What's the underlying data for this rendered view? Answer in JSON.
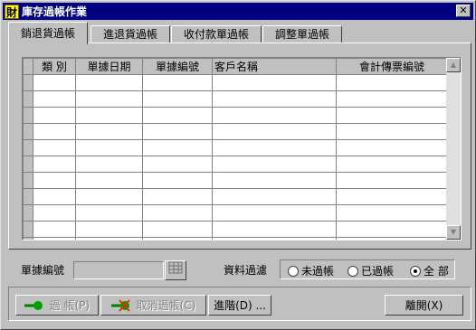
{
  "window": {
    "title": "庫存過帳作業",
    "app_icon_text": "財",
    "close_symbol": "✕"
  },
  "tabs": [
    {
      "label": "銷退貨過帳",
      "active": true
    },
    {
      "label": "進退貨過帳",
      "active": false
    },
    {
      "label": "收付款單過帳",
      "active": false
    },
    {
      "label": "調整單過帳",
      "active": false
    }
  ],
  "grid": {
    "columns": [
      "類 別",
      "單據日期",
      "單據編號",
      "客戶名稱",
      "會計傳票編號"
    ],
    "row_count": 11,
    "rows": []
  },
  "filter": {
    "doc_no_label": "單據編號",
    "doc_no_value": "",
    "lookup_icon": "grid-lookup-icon",
    "status_label": "資料過濾",
    "options": [
      {
        "label": "未過帳",
        "checked": false
      },
      {
        "label": "已過帳",
        "checked": false
      },
      {
        "label": "全 部",
        "checked": true
      }
    ]
  },
  "buttons": {
    "post": "過 帳(P)",
    "cancel_post": "取消過帳(C)",
    "advanced": "進階(D) ...",
    "exit": "離開(X)"
  },
  "colors": {
    "titlebar": "#000080",
    "face": "#c0c0c0",
    "post_icon": "#008000",
    "cancel_icon": "#e03000"
  }
}
